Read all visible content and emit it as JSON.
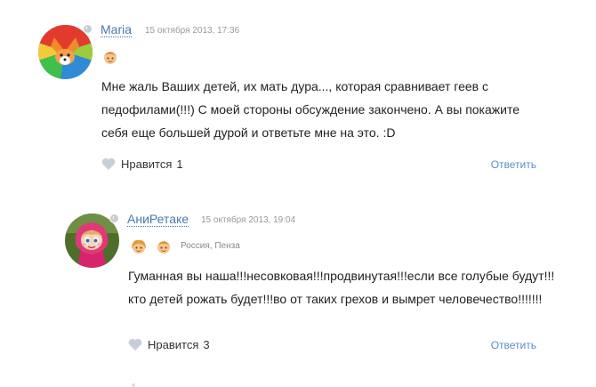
{
  "comments": [
    {
      "author": "Maria",
      "date": "15 октября 2013, 17:36",
      "location": "",
      "text": "Мне жаль Ваших детей, их мать дура..., которая сравнивает геев с педофилами(!!!) С моей стороны обсуждение закончено. А вы покажите себя еще большей дурой и ответьте мне на это. :D",
      "like_label": "Нравится",
      "like_count": "1",
      "reply_label": "Ответить"
    },
    {
      "author": "АниРетаке",
      "date": "15 октября 2013, 19:04",
      "location": "Россия, Пенза",
      "text": "Гуманная вы наша!!!несовковая!!!продвинутая!!!если все голубые будут!!!кто детей рожать будет!!!во от таких грехов и вымрет человечество!!!!!!!",
      "like_label": "Нравится",
      "like_count": "3",
      "reply_label": "Ответить"
    }
  ],
  "colors": {
    "link": "#4a78a8",
    "reply": "#5b8ec2",
    "muted": "#999999",
    "heart": "#c8ced6"
  },
  "icons": [
    "fox-avatar",
    "masha-avatar",
    "boy-badge-icon",
    "girl-badge-icon",
    "heart-icon",
    "online-status-icon"
  ]
}
